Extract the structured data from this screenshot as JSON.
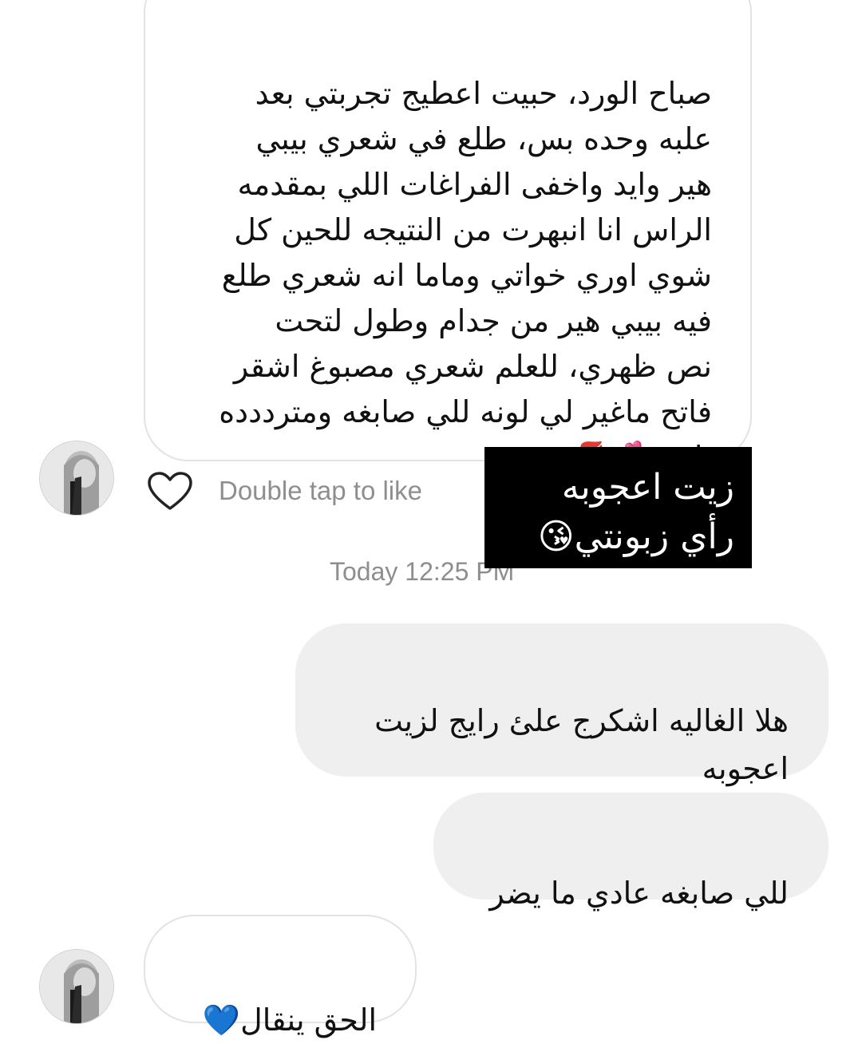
{
  "messages": [
    {
      "direction": "incoming",
      "text": "صباح الورد، حبيت اعطيج تجربتي بعد\nعلبه وحده بس، طلع في شعري بيبي\nهير وايد واخفى الفراغات اللي بمقدمه\nالراس انا انبهرت من النتيجه للحين كل\nشوي اوري خواتي وماما انه شعري طلع\nفيه بيبي هير من جدام وطول لتحت\nنص ظهري، للعلم شعري مصبوغ اشقر\nفاتح ماغير لي لونه للي صابغه ومترددده\nتاخذه💕💋"
    },
    {
      "direction": "outgoing",
      "text": "هلا الغاليه اشكرج علئ رايج لزيت\nاعجوبه"
    },
    {
      "direction": "outgoing",
      "text": "للي صابغه عادي ما يضر"
    },
    {
      "direction": "incoming",
      "text": "الحق ينقال💙"
    }
  ],
  "like_hint": "Double tap to like",
  "timestamp": "Today 12:25 PM",
  "overlay_caption": "زيت اعجوبه\nرأي زبونتي😘",
  "icons": {
    "like": "heart-outline-icon",
    "avatar": "profile-avatar"
  },
  "colors": {
    "incoming_bubble_border": "#e3e3e3",
    "outgoing_bubble_bg": "#efefef",
    "meta_text": "#8e8e8e",
    "overlay_bg": "#000000"
  }
}
